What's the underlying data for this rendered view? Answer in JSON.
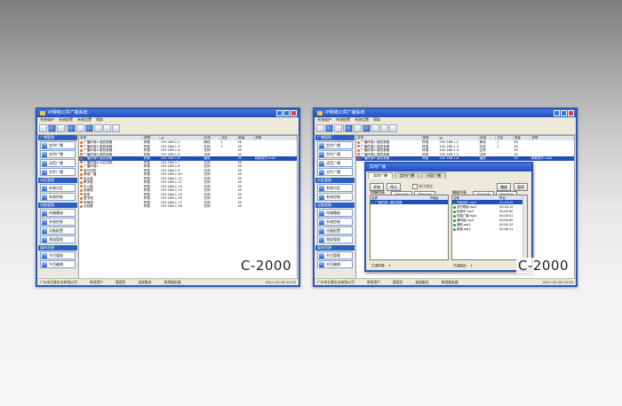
{
  "brand_label": "C-2000",
  "window": {
    "title": "IP网络公共广播系统",
    "menu": [
      "系统维护",
      "系统配置",
      "系统设置",
      "帮助"
    ],
    "status": {
      "company": "广州市艾普实业有限公司",
      "user_label": "系统用户",
      "user": "管理员",
      "state": "连接服务",
      "server": "系统服务器",
      "time": "2011-02-28 10:10"
    }
  },
  "sidebar": [
    {
      "title": "广播管理",
      "items": [
        "定时广播",
        "实时广播",
        "语音广播",
        "文件广播"
      ]
    },
    {
      "title": "分区管理",
      "items": [
        "系统分区",
        "系统控制"
      ]
    },
    {
      "title": "设备管理",
      "items": [
        "终端播放",
        "系统控制",
        "设备配置",
        "频道管理"
      ]
    },
    {
      "title": "媒体资源",
      "items": [
        "节目管理",
        "节目编辑"
      ]
    }
  ],
  "table": {
    "columns": [
      "名称",
      "类型",
      "IP",
      "状态",
      "分区",
      "音量",
      "说明"
    ],
    "rows": [
      [
        "广播终端1-楼层音箱",
        "终端",
        "192.168.1.2",
        "离线",
        "1",
        "40",
        ""
      ],
      [
        "广播终端2-楼层音箱",
        "终端",
        "192.168.1.3",
        "在线",
        "1",
        "40",
        ""
      ],
      [
        "广播终端3-楼层音箱",
        "终端",
        "192.168.1.4",
        "空闲",
        "",
        "40",
        ""
      ],
      [
        "广播终端4-楼层音箱",
        "终端",
        "192.168.1.5",
        "空闲",
        "",
        "40",
        ""
      ],
      [
        "广播终端5-楼层音箱",
        "终端",
        "192.168.1.6",
        "播放",
        "",
        "40",
        "背景音乐.mp3"
      ],
      [
        "广播终端6-分区控制",
        "终端",
        "192.168.1.7",
        "空闲",
        "",
        "40",
        ""
      ],
      [
        "广播终端7",
        "终端",
        "192.168.1.8",
        "空闲",
        "",
        "40",
        ""
      ],
      [
        "音乐控制",
        "终端",
        "192.168.1.9",
        "空闲",
        "",
        "40",
        ""
      ],
      [
        "操场广播",
        "终端",
        "192.168.1.10",
        "空闲",
        "",
        "40",
        ""
      ],
      [
        "会议室",
        "终端",
        "192.168.1.11",
        "空闲",
        "",
        "40",
        ""
      ],
      [
        "教学楼",
        "终端",
        "192.168.1.12",
        "空闲",
        "",
        "40",
        ""
      ],
      [
        "办公楼",
        "终端",
        "192.168.1.13",
        "空闲",
        "",
        "40",
        ""
      ],
      [
        "宿舍楼",
        "终端",
        "192.168.1.14",
        "空闲",
        "",
        "40",
        ""
      ],
      [
        "食堂",
        "终端",
        "192.168.1.15",
        "空闲",
        "",
        "40",
        ""
      ],
      [
        "图书馆",
        "终端",
        "192.168.1.16",
        "空闲",
        "",
        "40",
        ""
      ],
      [
        "体育馆",
        "终端",
        "192.168.1.17",
        "空闲",
        "",
        "40",
        ""
      ],
      [
        "实验楼",
        "终端",
        "192.168.1.18",
        "空闲",
        "",
        "40",
        ""
      ]
    ]
  },
  "dialog": {
    "title": "实时广播",
    "tabs": [
      "实时广播",
      "定时广播",
      "分区广播"
    ],
    "start_label": "开始",
    "stop_label": "停止",
    "loop_label": "循环播放",
    "play_label": "播放",
    "pause_label": "暂停",
    "left_title": "终端列表",
    "right_title": "播放列表",
    "add_all": "添加全部",
    "add_sel": "添加选中",
    "left_cols": [
      "名称",
      "IP地址"
    ],
    "left_rows": [
      [
        "广播终端1-楼层音箱",
        ""
      ]
    ],
    "right_cols": [
      "名称",
      "时长"
    ],
    "right_rows": [
      [
        "背景音乐.mp3",
        "00:03:56"
      ],
      [
        "流行歌曲.mp3",
        "00:04:12"
      ],
      [
        "轻音乐.mp3",
        "00:03:40"
      ],
      [
        "校园广播.mp3",
        "00:05:01"
      ],
      [
        "课间操.mp3",
        "00:04:30"
      ],
      [
        "通知.mp3",
        "00:01:20"
      ],
      [
        "新闻.mp3",
        "00:08:11"
      ]
    ],
    "left_footer": "已选终端:",
    "right_footer": "已选曲目:",
    "count": "1"
  }
}
